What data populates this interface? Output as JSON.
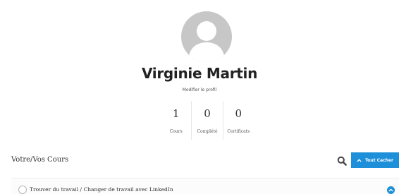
{
  "profile": {
    "name": "Virginie Martin",
    "edit_link": "Modifier le profil"
  },
  "stats": [
    {
      "value": "1",
      "label": "Cours"
    },
    {
      "value": "0",
      "label": "Complété"
    },
    {
      "value": "0",
      "label": "Certificats"
    }
  ],
  "courses_section": {
    "title": "Votre/Vos Cours",
    "search_icon": "search-icon",
    "hide_all_label": "Tout Cacher",
    "hide_all_icon": "chevron-up-icon"
  },
  "courses": [
    {
      "title": "Trouver du travail / Changer de travail avec LinkedIn",
      "toggle_icon": "chevron-up-icon"
    }
  ],
  "colors": {
    "accent": "#1e8fd9",
    "avatar_bg": "#c7c7c7",
    "text": "#333333"
  }
}
